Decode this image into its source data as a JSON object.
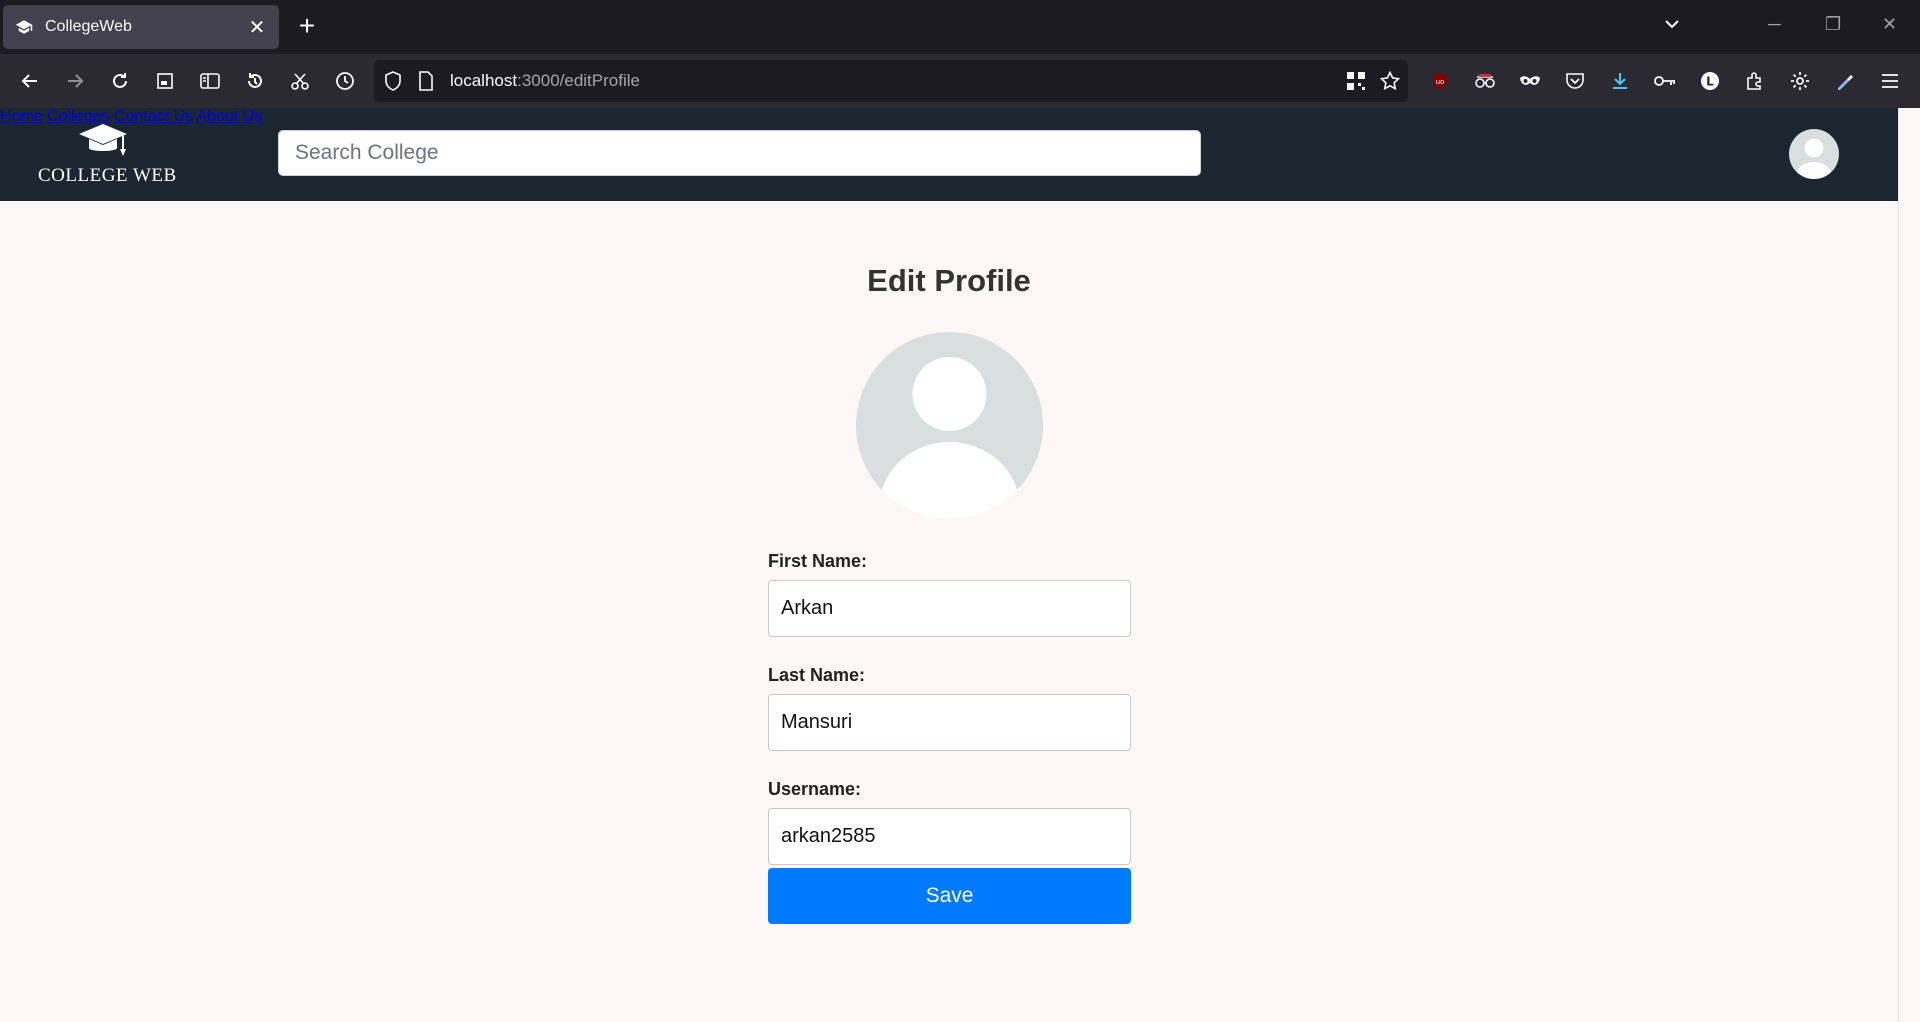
{
  "browser": {
    "tab_title": "CollegeWeb",
    "url_host": "localhost",
    "url_path": ":3000/editProfile"
  },
  "site": {
    "logo_text": "COLLEGE WEB",
    "search_placeholder": "Search College",
    "nav": {
      "home": "Home",
      "colleges": "Colleges",
      "contact": "Contact Us",
      "about": "About Us"
    }
  },
  "page": {
    "title": "Edit Profile",
    "fields": {
      "first_name_label": "First Name:",
      "first_name_value": "Arkan",
      "last_name_label": "Last Name:",
      "last_name_value": "Mansuri",
      "username_label": "Username:",
      "username_value": "arkan2585"
    },
    "save_label": "Save"
  },
  "colors": {
    "header_bg": "#1b2630",
    "page_bg": "#fdf8f7",
    "primary_button": "#007bff",
    "avatar_bg": "#d9dfe1"
  }
}
